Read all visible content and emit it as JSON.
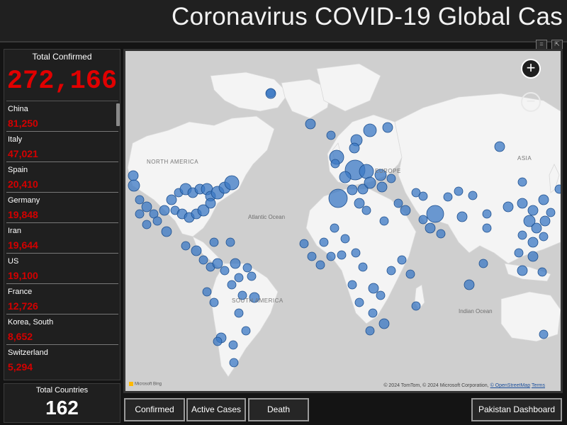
{
  "header": {
    "title": "Coronavirus COVID-19 Global Cas"
  },
  "visual_header_icons": [
    "filter-icon",
    "focus-mode-icon"
  ],
  "summary": {
    "total_confirmed_label": "Total Confirmed",
    "total_confirmed_value": "272,166",
    "total_countries_label": "Total Countries",
    "total_countries_value": "162"
  },
  "countries": [
    {
      "name": "China",
      "count": "81,250"
    },
    {
      "name": "Italy",
      "count": "47,021"
    },
    {
      "name": "Spain",
      "count": "20,410"
    },
    {
      "name": "Germany",
      "count": "19,848"
    },
    {
      "name": "Iran",
      "count": "19,644"
    },
    {
      "name": "US",
      "count": "19,100"
    },
    {
      "name": "France",
      "count": "12,726"
    },
    {
      "name": "Korea, South",
      "count": "8,652"
    },
    {
      "name": "Switzerland",
      "count": "5,294"
    }
  ],
  "map": {
    "labels": {
      "north_america": "NORTH AMERICA",
      "europe": "EUROPE",
      "asia": "ASIA",
      "south_america": "SOUTH AMERICA",
      "atlantic": "Atlantic Ocean",
      "indian": "Indian Ocean"
    },
    "attribution": "© 2024 TomTom, © 2024 Microsoft Corporation,",
    "attribution_link": "© OpenStreetMap",
    "terms": "Terms",
    "bing": "Microsoft Bing",
    "zoom_in": "+",
    "zoom_out": "−",
    "bubble_color": "#3b78c4"
  },
  "buttons": {
    "confirmed": "Confirmed",
    "active": "Active Cases",
    "death": "Death",
    "pakistan": "Pakistan Dashboard"
  }
}
